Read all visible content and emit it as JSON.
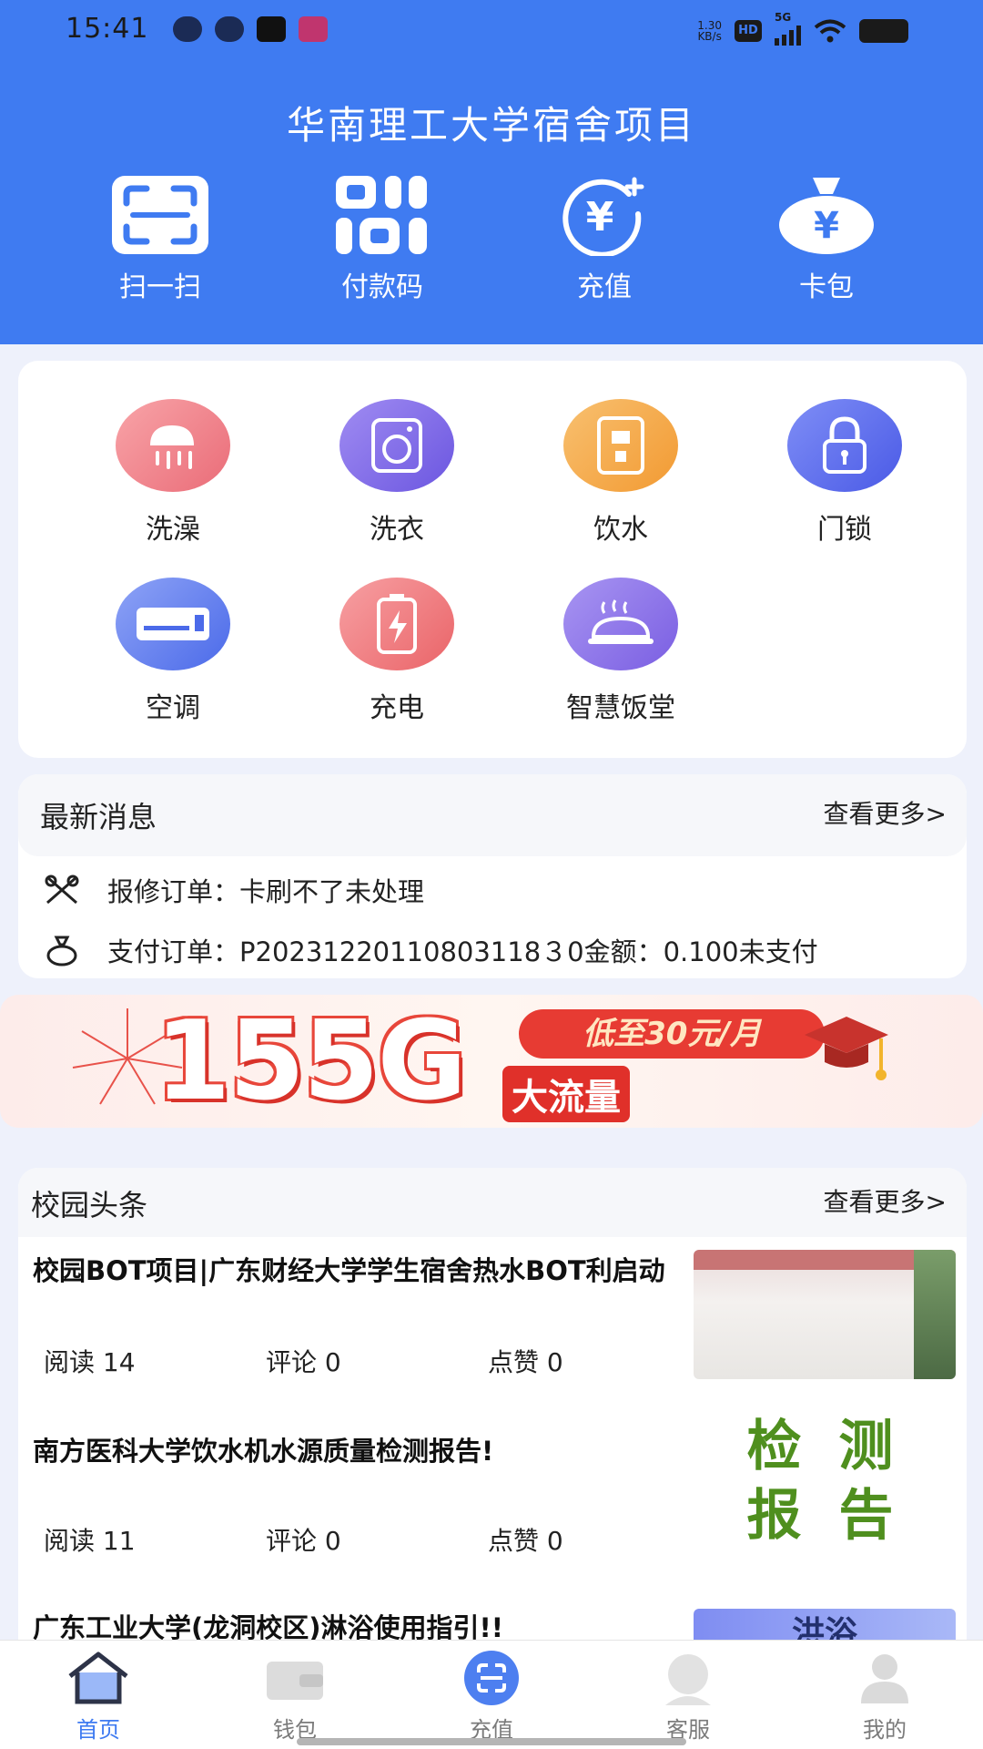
{
  "status_bar": {
    "time": "15:41",
    "net_speed_value": "1.30",
    "net_speed_unit": "KB/s",
    "hd": "HD",
    "network": "5G"
  },
  "header": {
    "title": "华南理工大学宿舍项目",
    "quick_actions": [
      {
        "label": "扫一扫",
        "icon": "scan-icon"
      },
      {
        "label": "付款码",
        "icon": "payment-code-icon"
      },
      {
        "label": "充值",
        "icon": "recharge-icon"
      },
      {
        "label": "卡包",
        "icon": "card-wallet-icon"
      }
    ]
  },
  "services": [
    {
      "label": "洗澡",
      "icon": "shower-icon",
      "color": "#ef7a84"
    },
    {
      "label": "洗衣",
      "icon": "washing-machine-icon",
      "color": "#7b68e6"
    },
    {
      "label": "饮水",
      "icon": "water-dispenser-icon",
      "color": "#f4a640"
    },
    {
      "label": "门锁",
      "icon": "door-lock-icon",
      "color": "#5b6cf0"
    },
    {
      "label": "空调",
      "icon": "air-conditioner-icon",
      "color": "#5f7df2"
    },
    {
      "label": "充电",
      "icon": "charging-icon",
      "color": "#ef7477"
    },
    {
      "label": "智慧饭堂",
      "icon": "canteen-icon",
      "color": "#8c74ea"
    }
  ],
  "news": {
    "title": "最新消息",
    "more": "查看更多>",
    "items": [
      {
        "icon": "repair-tools-icon",
        "text": "报修订单：卡刷不了未处理"
      },
      {
        "icon": "money-bag-icon",
        "text": "支付订单：P20231220110803118３0金额：0.100未支付"
      }
    ]
  },
  "banner": {
    "big_text": "155G",
    "pill_text": "低至30元/月",
    "sub_text": "大流量"
  },
  "campus": {
    "title": "校园头条",
    "more": "查看更多>",
    "articles": [
      {
        "title": "校园BOT项目|广东财经大学学生宿舍热水BOT利启动",
        "reads": "阅读 14",
        "comments": "评论 0",
        "likes": "点赞 0"
      },
      {
        "title": "南方医科大学饮水机水源质量检测报告!",
        "reads": "阅读 11",
        "comments": "评论 0",
        "likes": "点赞 0",
        "thumb_text_1": "检 测",
        "thumb_text_2": "报 告"
      },
      {
        "title": "广东工业大学(龙洞校区)淋浴使用指引!!",
        "thumb_text_1": "洪浴"
      }
    ]
  },
  "tabbar": [
    {
      "label": "首页",
      "icon": "home-icon",
      "active": true
    },
    {
      "label": "钱包",
      "icon": "wallet-icon",
      "active": false
    },
    {
      "label": "充值",
      "icon": "recharge-tab-icon",
      "active": false
    },
    {
      "label": "客服",
      "icon": "customer-service-icon",
      "active": false
    },
    {
      "label": "我的",
      "icon": "profile-icon",
      "active": false
    }
  ],
  "colors": {
    "primary": "#3f7bf1",
    "background": "#eef1fb"
  }
}
